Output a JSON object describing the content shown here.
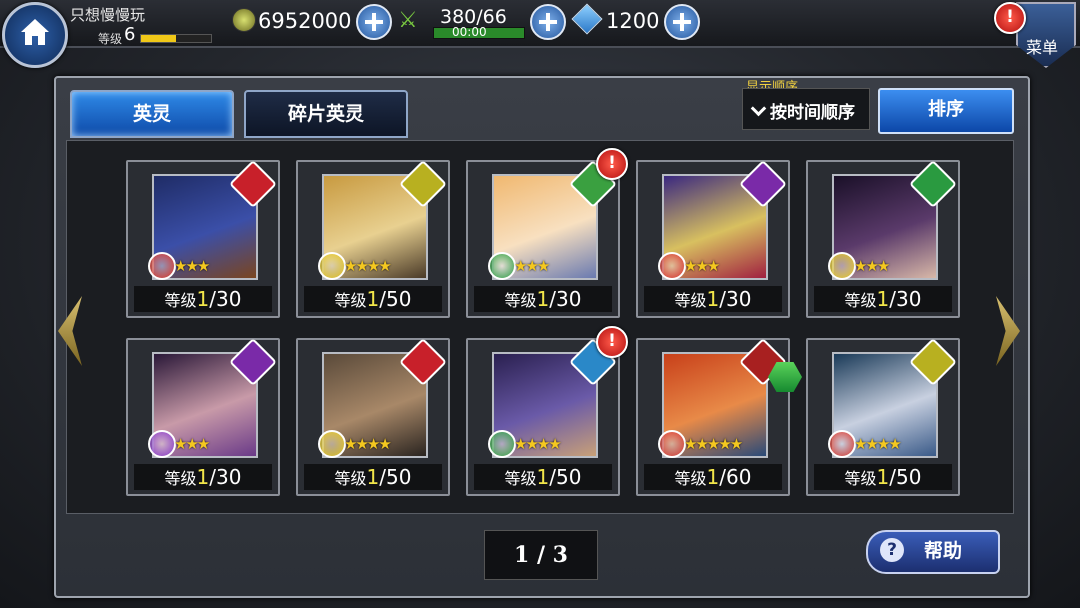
{
  "player": {
    "name": "只想慢慢玩",
    "level_label": "等级",
    "level": "6",
    "level_progress": 0.5
  },
  "resources": {
    "gold": "6952000",
    "stamina": "380/66",
    "stamina_timer": "00:00",
    "crystals": "1200"
  },
  "menu": {
    "label": "菜单"
  },
  "tabs": [
    {
      "label": "英灵",
      "active": true
    },
    {
      "label": "碎片英灵",
      "active": false
    }
  ],
  "sort": {
    "heading": "显示顺序",
    "current": "按时间顺序",
    "button": "排序"
  },
  "heroes": [
    {
      "level": "1",
      "max": "/30",
      "stars": "★★★",
      "class_color": "#c8202a",
      "element_color": "#d8342a",
      "portrait": [
        "#1f2c66",
        "#3b4fa8",
        "#7a4520"
      ],
      "alert": false
    },
    {
      "level": "1",
      "max": "/50",
      "stars": "★★★★",
      "class_color": "#b8b020",
      "element_color": "#e2c31e",
      "portrait": [
        "#c89a40",
        "#e8d090",
        "#4a3a28"
      ],
      "alert": false
    },
    {
      "level": "1",
      "max": "/30",
      "stars": "★★★",
      "class_color": "#3aa040",
      "element_color": "#2ea040",
      "portrait": [
        "#f0b870",
        "#f8e0c0",
        "#6a7ab0"
      ],
      "alert": true
    },
    {
      "level": "1",
      "max": "/30",
      "stars": "★★★",
      "class_color": "#7a2aa8",
      "element_color": "#d8342a",
      "portrait": [
        "#3a2880",
        "#d8c060",
        "#a02040"
      ],
      "alert": false
    },
    {
      "level": "1",
      "max": "/30",
      "stars": "★★★",
      "class_color": "#2a9a40",
      "element_color": "#e2c31e",
      "portrait": [
        "#1a1028",
        "#5a3a6a",
        "#d8b8a8"
      ],
      "alert": false
    },
    {
      "level": "1",
      "max": "/30",
      "stars": "★★★",
      "class_color": "#7a2aa8",
      "element_color": "#8a38c8",
      "portrait": [
        "#2a1838",
        "#c89aa8",
        "#6a3a88"
      ],
      "alert": false
    },
    {
      "level": "1",
      "max": "/50",
      "stars": "★★★★",
      "class_color": "#c8202a",
      "element_color": "#e2c31e",
      "portrait": [
        "#5a4a3a",
        "#a88868",
        "#2a2420"
      ],
      "alert": false
    },
    {
      "level": "1",
      "max": "/50",
      "stars": "★★★★",
      "class_color": "#2a88c8",
      "element_color": "#2ea040",
      "portrait": [
        "#2a2050",
        "#6a5aa8",
        "#c8a078"
      ],
      "alert": true
    },
    {
      "level": "1",
      "max": "/60",
      "stars": "★★★★★",
      "class_color": "#a82020",
      "element_color": "#d8342a",
      "portrait": [
        "#c8401a",
        "#e88a48",
        "#2a4a78"
      ],
      "alert": false
    },
    {
      "level": "1",
      "max": "/50",
      "stars": "★★★★",
      "class_color": "#b8b020",
      "element_color": "#d8342a",
      "portrait": [
        "#1a3a58",
        "#c8d0e0",
        "#3a5a88"
      ],
      "alert": false
    }
  ],
  "level_prefix": "等级",
  "pager": {
    "text": "1 / 3"
  },
  "help": {
    "label": "帮助"
  }
}
